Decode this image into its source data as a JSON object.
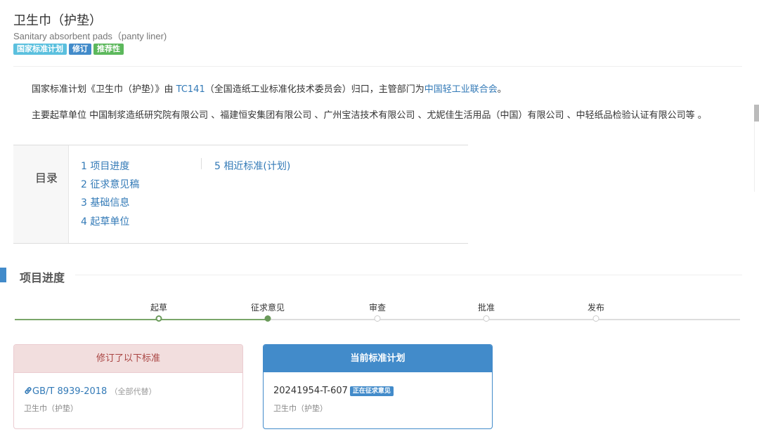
{
  "header": {
    "title": "卫生巾（护垫）",
    "subtitle": "Sanitary absorbent pads（panty liner)",
    "badges": [
      {
        "label": "国家标准计划",
        "color": "#5bc0de"
      },
      {
        "label": "修订",
        "color": "#428bca"
      },
      {
        "label": "推荐性",
        "color": "#5cb85c"
      }
    ]
  },
  "intro": {
    "line1_prefix": "国家标准计划《卫生巾（护垫）》由 ",
    "tc_code": "TC141",
    "line1_middle": "（全国造纸工业标准化技术委员会）归口，主管部门为",
    "department": "中国轻工业联合会",
    "line1_suffix": "。",
    "line2": "主要起草单位 中国制浆造纸研究院有限公司 、福建恒安集团有限公司 、广州宝洁技术有限公司 、尤妮佳生活用品（中国）有限公司 、中轻纸品检验认证有限公司等 。"
  },
  "toc": {
    "heading": "目录",
    "items": [
      "1  项目进度",
      "2  征求意见稿",
      "3  基础信息",
      "4  起草单位",
      "5  相近标准(计划)"
    ]
  },
  "progress": {
    "section_title": "项目进度",
    "steps": [
      "起草",
      "征求意见",
      "审查",
      "批准",
      "发布"
    ],
    "completed_steps": 2
  },
  "cards": {
    "revised": {
      "title": "修订了以下标准",
      "link_icon": "link-icon",
      "std_code": "GB/T 8939-2018",
      "note": "（全部代替）",
      "name": "卫生巾（护垫）"
    },
    "current": {
      "title": "当前标准计划",
      "plan_no": "20241954-T-607",
      "status": "正在征求意见",
      "name": "卫生巾（护垫）"
    }
  }
}
